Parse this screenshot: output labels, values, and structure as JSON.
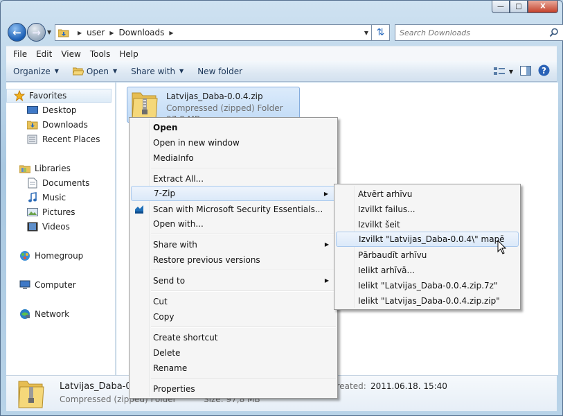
{
  "window": {
    "minimize": "—",
    "maximize": "□",
    "close": "X"
  },
  "address": {
    "crumbs": [
      "user",
      "Downloads"
    ],
    "search_placeholder": "Search Downloads"
  },
  "menubar": [
    "File",
    "Edit",
    "View",
    "Tools",
    "Help"
  ],
  "commands": {
    "organize": "Organize",
    "open": "Open",
    "share_with": "Share with",
    "new_folder": "New folder"
  },
  "navpane": {
    "favorites": "Favorites",
    "desktop": "Desktop",
    "downloads": "Downloads",
    "recent_places": "Recent Places",
    "libraries": "Libraries",
    "documents": "Documents",
    "music": "Music",
    "pictures": "Pictures",
    "videos": "Videos",
    "homegroup": "Homegroup",
    "computer": "Computer",
    "network": "Network"
  },
  "file": {
    "name": "Latvijas_Daba-0.0.4.zip",
    "type": "Compressed (zipped) Folder",
    "size": "97,8 MB"
  },
  "details": {
    "name": "Latvijas_Daba-0.0",
    "type": "Compressed (zipped) Folder",
    "size_label": "Size: 97,8 MB",
    "created_label": "created:",
    "created_value": "2011.06.18. 15:40"
  },
  "context_menu": {
    "open": "Open",
    "open_new_window": "Open in new window",
    "mediainfo": "MediaInfo",
    "extract_all": "Extract All...",
    "seven_zip": "7-Zip",
    "scan": "Scan with Microsoft Security Essentials...",
    "open_with": "Open with...",
    "share_with": "Share with",
    "restore": "Restore previous versions",
    "send_to": "Send to",
    "cut": "Cut",
    "copy": "Copy",
    "create_shortcut": "Create shortcut",
    "delete": "Delete",
    "rename": "Rename",
    "properties": "Properties"
  },
  "submenu_7zip": {
    "open_archive": "Atvērt arhīvu",
    "extract_files": "Izvilkt failus...",
    "extract_here": "Izvilkt šeit",
    "extract_to": "Izvilkt \"Latvijas_Daba-0.0.4\\\" mapē",
    "test_archive": "Pārbaudīt arhīvu",
    "add_to_archive": "Ielikt arhīvā...",
    "add_to_7z": "Ielikt \"Latvijas_Daba-0.0.4.zip.7z\"",
    "add_to_zip": "Ielikt \"Latvijas_Daba-0.0.4.zip.zip\""
  }
}
